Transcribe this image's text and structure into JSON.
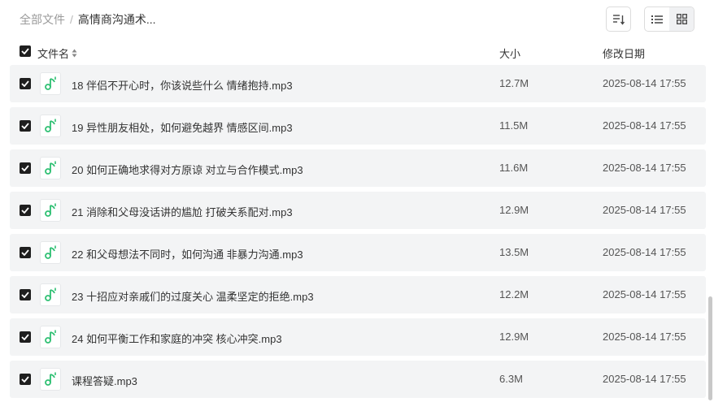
{
  "breadcrumb": {
    "root": "全部文件",
    "separator": "/",
    "current": "高情商沟通术..."
  },
  "toolbar": {
    "sort_icon": "sort-icon",
    "list_view_icon": "list-view-icon",
    "grid_view_icon": "grid-view-icon",
    "active_view": "list"
  },
  "table": {
    "headers": {
      "name": "文件名",
      "size": "大小",
      "date": "修改日期"
    },
    "rows": [
      {
        "name": "18 伴侣不开心时，你该说些什么 情绪抱持.mp3",
        "size": "12.7M",
        "date": "2025-08-14 17:55",
        "checked": true
      },
      {
        "name": "19 异性朋友相处，如何避免越界 情感区间.mp3",
        "size": "11.5M",
        "date": "2025-08-14 17:55",
        "checked": true
      },
      {
        "name": "20 如何正确地求得对方原谅 对立与合作模式.mp3",
        "size": "11.6M",
        "date": "2025-08-14 17:55",
        "checked": true
      },
      {
        "name": "21 消除和父母没话讲的尴尬 打破关系配对.mp3",
        "size": "12.9M",
        "date": "2025-08-14 17:55",
        "checked": true
      },
      {
        "name": "22 和父母想法不同时，如何沟通 非暴力沟通.mp3",
        "size": "13.5M",
        "date": "2025-08-14 17:55",
        "checked": true
      },
      {
        "name": "23 十招应对亲戚们的过度关心 温柔坚定的拒绝.mp3",
        "size": "12.2M",
        "date": "2025-08-14 17:55",
        "checked": true
      },
      {
        "name": "24 如何平衡工作和家庭的冲突 核心冲突.mp3",
        "size": "12.9M",
        "date": "2025-08-14 17:55",
        "checked": true
      },
      {
        "name": "课程答疑.mp3",
        "size": "6.3M",
        "date": "2025-08-14 17:55",
        "checked": true
      }
    ]
  },
  "colors": {
    "accent_green": "#2fc073",
    "row_bg": "#f3f4f5",
    "checkbox": "#1f1f1f"
  }
}
